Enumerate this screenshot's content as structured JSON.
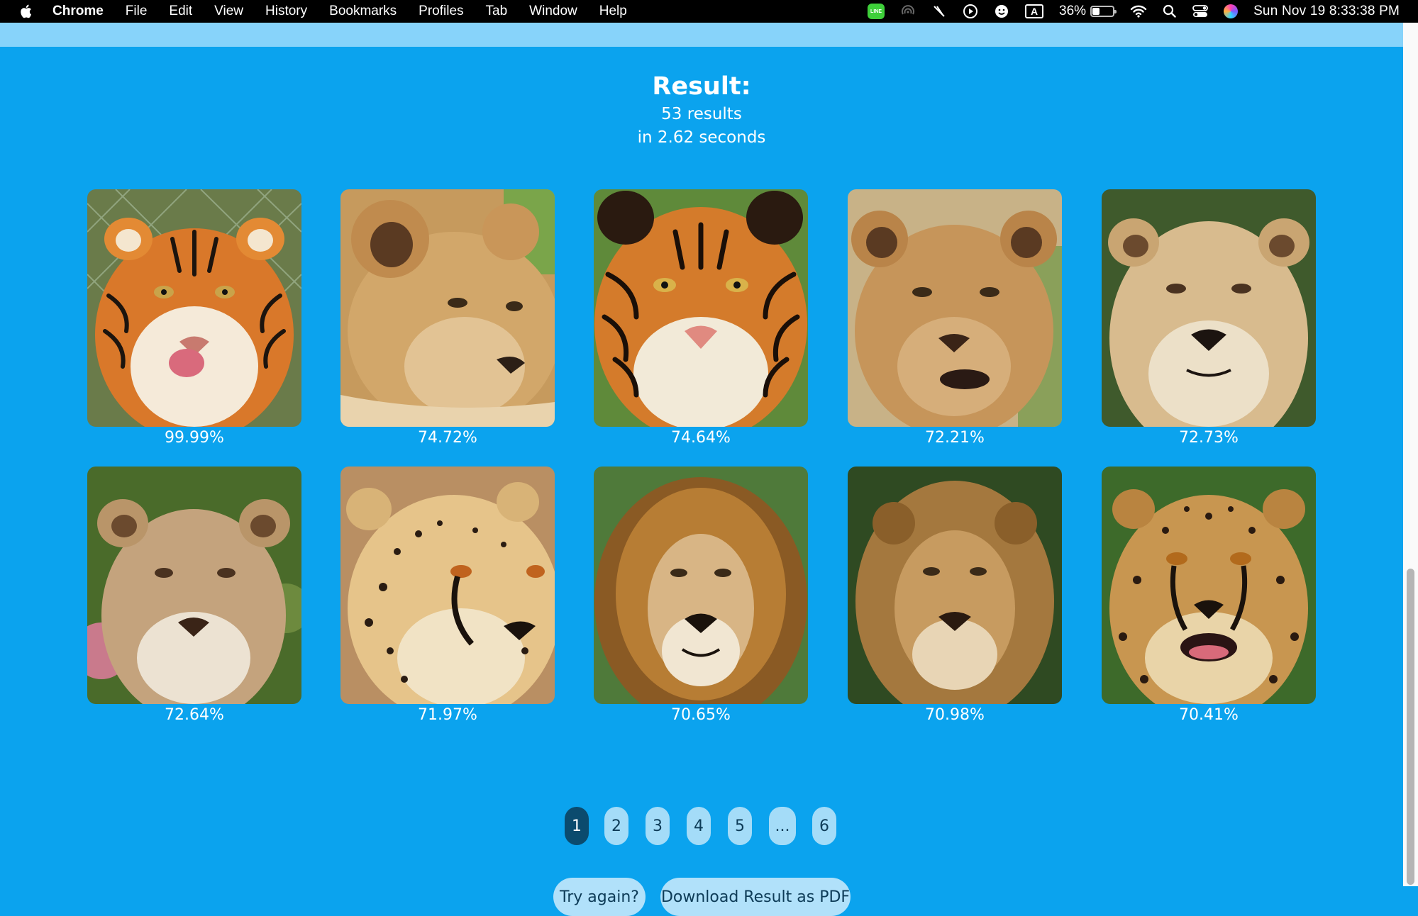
{
  "menubar": {
    "app": "Chrome",
    "items": [
      "File",
      "Edit",
      "View",
      "History",
      "Bookmarks",
      "Profiles",
      "Tab",
      "Window",
      "Help"
    ],
    "line_label": "LINE",
    "input_indicator": "A",
    "battery": "36%",
    "clock": "Sun Nov 19  8:33:38 PM"
  },
  "result": {
    "title": "Result:",
    "count": "53 results",
    "time": "in 2.62 seconds"
  },
  "cards": [
    {
      "animal": "tiger",
      "score": "99.99%"
    },
    {
      "animal": "lion cub",
      "score": "74.72%"
    },
    {
      "animal": "tiger",
      "score": "74.64%"
    },
    {
      "animal": "lioness",
      "score": "72.21%"
    },
    {
      "animal": "lioness",
      "score": "72.73%"
    },
    {
      "animal": "lioness",
      "score": "72.64%"
    },
    {
      "animal": "cheetah",
      "score": "71.97%"
    },
    {
      "animal": "lion",
      "score": "70.65%"
    },
    {
      "animal": "lion",
      "score": "70.98%"
    },
    {
      "animal": "cheetah",
      "score": "70.41%"
    }
  ],
  "pagination": {
    "pages": [
      "1",
      "2",
      "3",
      "4",
      "5",
      "...",
      "6"
    ],
    "current": "1"
  },
  "actions": {
    "try_again": "Try again?",
    "download": "Download Result as PDF"
  },
  "colors": {
    "background": "#0ba3ee",
    "strip": "#87d3fa",
    "active_page": "#0b4b6e",
    "button": "#a4dcf8"
  }
}
